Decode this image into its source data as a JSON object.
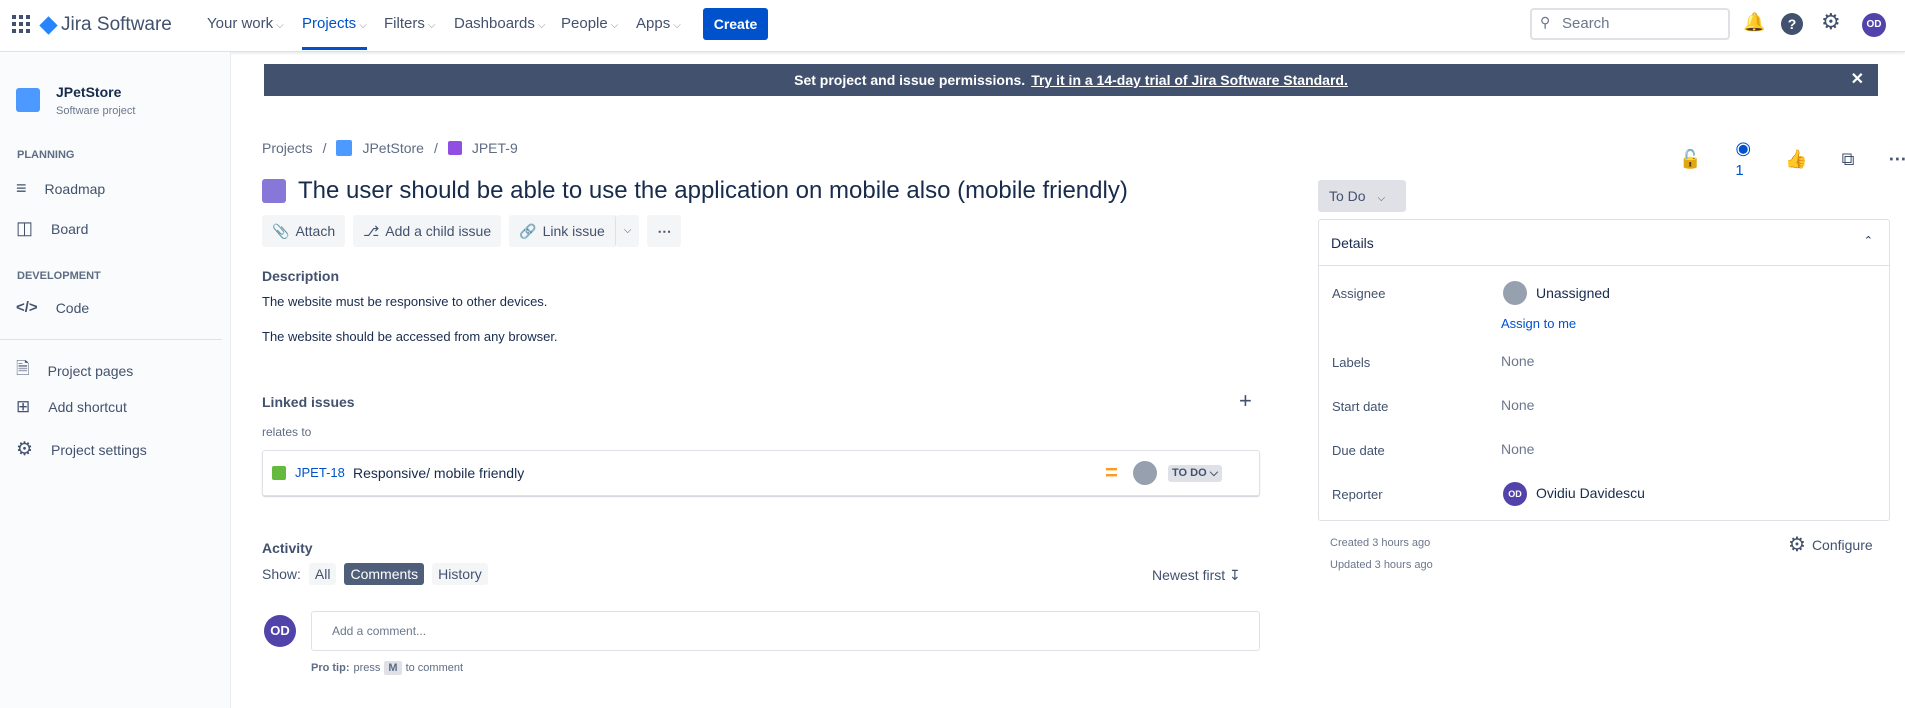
{
  "topnav": {
    "app_name": "Jira Software",
    "items": [
      {
        "label": "Your work"
      },
      {
        "label": "Projects"
      },
      {
        "label": "Filters"
      },
      {
        "label": "Dashboards"
      },
      {
        "label": "People"
      },
      {
        "label": "Apps"
      }
    ],
    "create": "Create",
    "search_placeholder": "Search",
    "user_initials": "OD"
  },
  "sidebar": {
    "project_name": "JPetStore",
    "project_type": "Software project",
    "planning": "PLANNING",
    "roadmap": "Roadmap",
    "board": "Board",
    "development": "DEVELOPMENT",
    "code": "Code",
    "project_pages": "Project pages",
    "add_shortcut": "Add shortcut",
    "project_settings": "Project settings"
  },
  "banner": {
    "text": "Set project and issue permissions.",
    "link": "Try it in a 14-day trial of Jira Software Standard."
  },
  "breadcrumb": {
    "projects": "Projects",
    "project": "JPetStore",
    "issue": "JPET-9"
  },
  "issue": {
    "title": "The user should be able to use the application on mobile also (mobile friendly)",
    "watchers": "1",
    "status": "To Do"
  },
  "actions": {
    "attach": "Attach",
    "child": "Add a child issue",
    "link": "Link issue"
  },
  "description": {
    "heading": "Description",
    "lines": [
      "The website must be responsive to other devices.",
      "The website should be accessed from any browser."
    ]
  },
  "linked": {
    "heading": "Linked issues",
    "relation": "relates to",
    "items": [
      {
        "key": "JPET-18",
        "summary": "Responsive/ mobile friendly",
        "status": "TO DO"
      }
    ]
  },
  "activity": {
    "heading": "Activity",
    "show": "Show:",
    "filters": [
      "All",
      "Comments",
      "History"
    ],
    "sort": "Newest first",
    "comment_placeholder": "Add a comment...",
    "user_initials": "OD",
    "protip_bold": "Pro tip:",
    "protip_press": "press",
    "protip_key": "M",
    "protip_rest": "to comment"
  },
  "details": {
    "heading": "Details",
    "assignee_label": "Assignee",
    "assignee": "Unassigned",
    "assign_me": "Assign to me",
    "labels_label": "Labels",
    "labels": "None",
    "start_label": "Start date",
    "start": "None",
    "due_label": "Due date",
    "due": "None",
    "reporter_label": "Reporter",
    "reporter": "Ovidiu Davidescu",
    "reporter_initials": "OD"
  },
  "meta": {
    "created": "Created 3 hours ago",
    "updated": "Updated 3 hours ago",
    "configure": "Configure"
  }
}
